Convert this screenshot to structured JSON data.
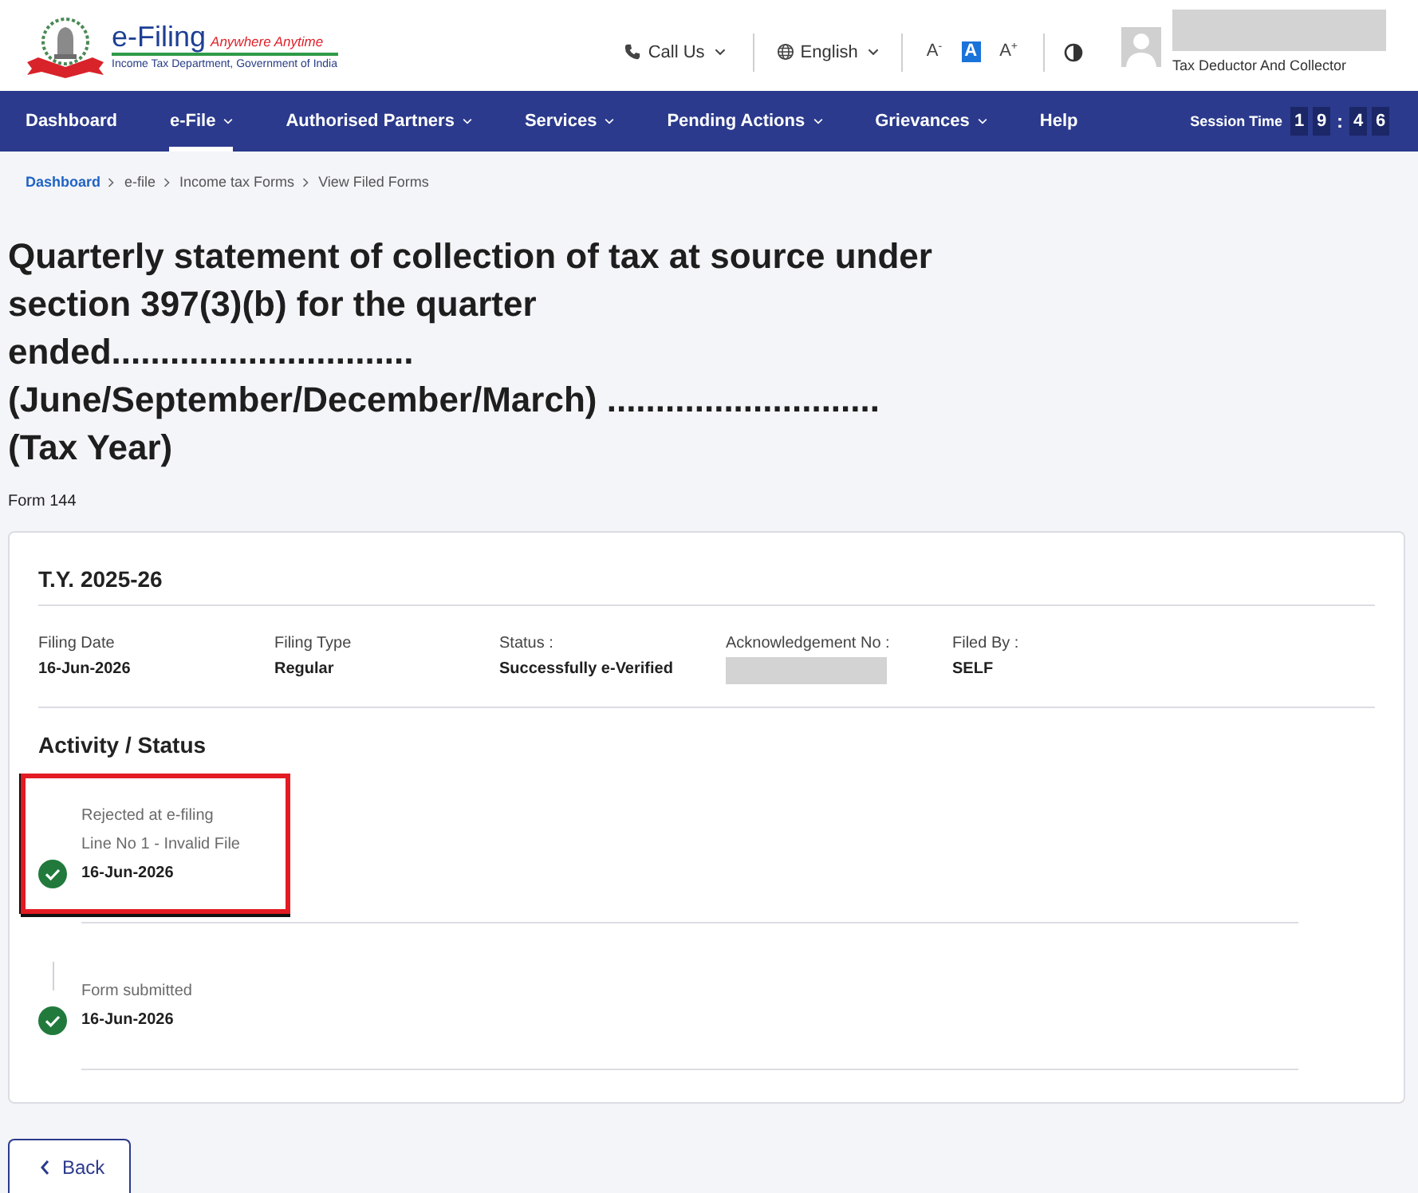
{
  "header": {
    "logo": {
      "title": "e-Filing",
      "tagline": "Anywhere Anytime",
      "subtitle": "Income Tax Department, Government of India"
    },
    "call_us": {
      "label": "Call Us",
      "has_menu": true
    },
    "language": {
      "label": "English",
      "has_menu": true
    },
    "font_controls": [
      {
        "label": "A$^{-}$",
        "selected": false
      },
      {
        "label": "A",
        "selected": true
      },
      {
        "label": "A$^{+}$",
        "selected": false
      }
    ],
    "user": {
      "role": "Tax Deductor And Collector"
    }
  },
  "nav": {
    "items": [
      {
        "label": "Dashboard",
        "has_menu": false,
        "selected": false
      },
      {
        "label": "e-File",
        "has_menu": true,
        "selected": true
      },
      {
        "label": "Authorised Partners",
        "has_menu": true,
        "selected": false
      },
      {
        "label": "Services",
        "has_menu": true,
        "selected": false
      },
      {
        "label": "Pending Actions",
        "has_menu": true,
        "selected": false
      },
      {
        "label": "Grievances",
        "has_menu": true,
        "selected": false
      },
      {
        "label": "Help",
        "has_menu": false,
        "selected": false
      }
    ],
    "session": {
      "label": "Session Time",
      "minutes": [
        "1",
        "9"
      ],
      "separator": ":",
      "seconds": [
        "4",
        "6"
      ]
    }
  },
  "breadcrumb": [
    {
      "label": "Dashboard",
      "link": true
    },
    {
      "label": "e-file",
      "link": false
    },
    {
      "label": "Income tax Forms",
      "link": false
    },
    {
      "label": "View Filed Forms",
      "link": false
    }
  ],
  "page": {
    "title": "Quarterly statement of collection of tax at source under section 397(3)(b) for the quarter ended............................... (June/September/December/March) ............................ (Tax Year)",
    "form_number": "Form 144"
  },
  "filing": {
    "title": "T.Y. 2025-26",
    "fields": [
      {
        "label": "Filing Date",
        "kind": "text",
        "value": "16-Jun-2026"
      },
      {
        "label": "Filing Type",
        "kind": "text",
        "value": "Regular"
      },
      {
        "label": "Status :",
        "kind": "text",
        "value": "Successfully e-Verified"
      },
      {
        "label": "Acknowledgement No :",
        "kind": "redacted"
      },
      {
        "label": "Filed By :",
        "kind": "text",
        "value": "SELF"
      }
    ],
    "activity": {
      "title": "Activity / Status",
      "events": [
        {
          "lines": [
            "Rejected at e-filing",
            "Line No 1 - Invalid File"
          ],
          "date": "16-Jun-2026",
          "done": true,
          "highlighted": true
        },
        {
          "lines": [
            "Form submitted"
          ],
          "date": "16-Jun-2026",
          "done": true,
          "highlighted": false
        }
      ]
    }
  },
  "back_button": {
    "label": "Back"
  }
}
